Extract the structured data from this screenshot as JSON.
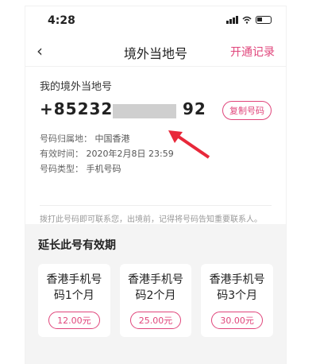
{
  "status_bar": {
    "time": "4:28"
  },
  "header": {
    "title": "境外当地号",
    "action": "开通记录"
  },
  "number_card": {
    "title": "我的境外当地号",
    "number_prefix": "+85232",
    "number_suffix": "92",
    "copy_button": "复制号码",
    "location_label": "号码归属地：",
    "location_value": "中国香港",
    "expiry_label": "有效时间：",
    "expiry_value": "2020年2月8日 23:59",
    "type_label": "号码类型：",
    "type_value": "手机号码"
  },
  "note": "拨打此号码即可联系您，出境前，记得将号码告知重要联系人。",
  "renew": {
    "title": "延长此号有效期",
    "plans": [
      {
        "name_line1": "香港手机号",
        "name_line2": "码1个月",
        "price": "12.00元"
      },
      {
        "name_line1": "香港手机号",
        "name_line2": "码2个月",
        "price": "25.00元"
      },
      {
        "name_line1": "香港手机号",
        "name_line2": "码3个月",
        "price": "30.00元"
      }
    ]
  },
  "colors": {
    "accent": "#e0457b",
    "arrow": "#e8283a"
  }
}
